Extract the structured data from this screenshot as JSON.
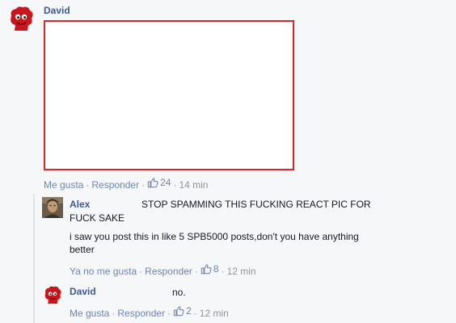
{
  "comments": [
    {
      "author": "David",
      "avatar_icon": "red-mascot-avatar-icon",
      "actions": {
        "like": "Me gusta",
        "reply": "Responder",
        "likes_count": "24",
        "time": "14 min"
      }
    },
    {
      "author": "Alex",
      "avatar_icon": "man-photo-avatar-icon",
      "text_line1": "STOP SPAMMING THIS FUCKING REACT PIC FOR",
      "text_line2": "FUCK SAKE",
      "text_line3": "i saw you post this in like 5 SPB5000 posts,don't you have anything",
      "text_line4": "better",
      "actions": {
        "like": "Ya no me gusta",
        "reply": "Responder",
        "likes_count": "8",
        "time": "12 min"
      }
    },
    {
      "author": "David",
      "avatar_icon": "red-mascot-avatar-icon",
      "text": "no.",
      "actions": {
        "like": "Me gusta",
        "reply": "Responder",
        "likes_count": "2",
        "time": "12 min"
      }
    }
  ],
  "colors": {
    "link": "#6d84b4",
    "name": "#3b5998",
    "image_border": "#d9262e"
  }
}
